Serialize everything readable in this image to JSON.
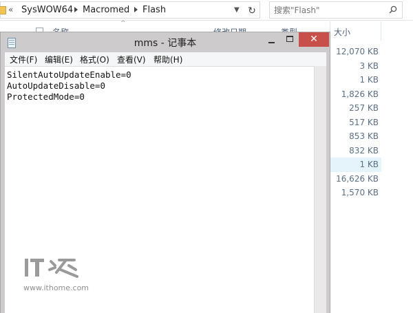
{
  "explorer": {
    "breadcrumb": {
      "overflow": "«",
      "items": [
        "SysWOW64",
        "Macromed",
        "Flash"
      ]
    },
    "search": {
      "placeholder": "搜索\"Flash\""
    },
    "columns": {
      "name": "名称",
      "date": "修改日期",
      "type": "类型",
      "size": "大小"
    },
    "sizes": [
      "12,070 KB",
      "3 KB",
      "1 KB",
      "1,826 KB",
      "257 KB",
      "517 KB",
      "853 KB",
      "832 KB",
      "1 KB",
      "16,626 KB",
      "1,570 KB"
    ],
    "selected_row": 8
  },
  "notepad": {
    "title": "mms - 记事本",
    "menu": [
      "文件(F)",
      "编辑(E)",
      "格式(O)",
      "查看(V)",
      "帮助(H)"
    ],
    "lines": [
      "SilentAutoUpdateEnable=0",
      "AutoUpdateDisable=0",
      "ProtectedMode=0"
    ],
    "close_glyph": "✕"
  },
  "watermark": {
    "logo": "IT之家",
    "url": "www.ithome.com"
  },
  "colors": {
    "close_button": "#c7504a",
    "selection": "#e5f3fb",
    "title_bar": "#cdcbcb"
  }
}
